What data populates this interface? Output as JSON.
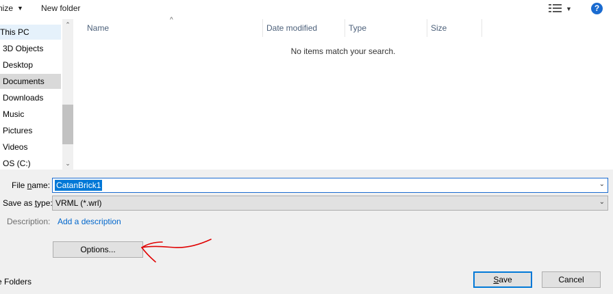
{
  "toolbar": {
    "organize_label": "nize",
    "new_folder_label": "New folder",
    "view_icon": "details-view-icon",
    "help_icon": "help-icon",
    "help_glyph": "?"
  },
  "nav": {
    "items": [
      {
        "label": "This PC",
        "state": "selected-light"
      },
      {
        "label": "3D Objects",
        "state": ""
      },
      {
        "label": "Desktop",
        "state": ""
      },
      {
        "label": "Documents",
        "state": "selected"
      },
      {
        "label": "Downloads",
        "state": ""
      },
      {
        "label": "Music",
        "state": ""
      },
      {
        "label": "Pictures",
        "state": ""
      },
      {
        "label": "Videos",
        "state": ""
      },
      {
        "label": "OS (C:)",
        "state": ""
      }
    ]
  },
  "list": {
    "columns": [
      "Name",
      "Date modified",
      "Type",
      "Size"
    ],
    "empty_message": "No items match your search."
  },
  "form": {
    "file_name_label_pre": "File ",
    "file_name_label_u": "n",
    "file_name_label_post": "ame:",
    "file_name_value": "CatanBrick1",
    "save_type_label_pre": "Save as ",
    "save_type_label_u": "t",
    "save_type_label_post": "ype:",
    "save_type_value": "VRML (*.wrl)",
    "description_label": "Description:",
    "description_link": "Add a description"
  },
  "buttons": {
    "options": "Options...",
    "save_u": "S",
    "save_rest": "ave",
    "cancel": "Cancel",
    "hide_folders": "e Folders"
  },
  "colors": {
    "accent": "#0078d7",
    "annotation": "#e00000",
    "link": "#0066cc"
  }
}
